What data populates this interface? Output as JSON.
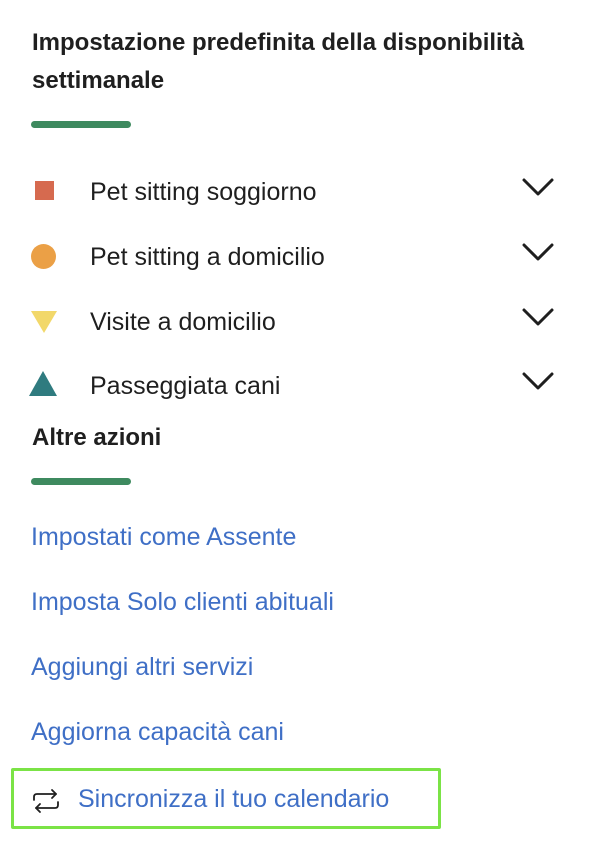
{
  "sections": {
    "default_availability_title": "Impostazione predefinita della disponibilità settimanale",
    "other_actions_title": "Altre azioni"
  },
  "services": [
    {
      "label": "Pet sitting soggiorno",
      "icon": "square-icon",
      "color": "#d66a4f"
    },
    {
      "label": "Pet sitting a domicilio",
      "icon": "circle-icon",
      "color": "#eba046"
    },
    {
      "label": "Visite a domicilio",
      "icon": "triangle-down-icon",
      "color": "#f2d86a"
    },
    {
      "label": "Passeggiata cani",
      "icon": "triangle-up-icon",
      "color": "#2f7b7f"
    }
  ],
  "actions": [
    {
      "label": "Impostati come Assente"
    },
    {
      "label": "Imposta Solo clienti abituali"
    },
    {
      "label": "Aggiungi altri servizi"
    },
    {
      "label": "Aggiorna capacità cani"
    }
  ],
  "sync": {
    "label": "Sincronizza il tuo calendario",
    "icon": "sync-icon"
  },
  "colors": {
    "accent_underline": "#3e8a5f",
    "link": "#3f6fc6",
    "highlight_border": "#7be346"
  }
}
